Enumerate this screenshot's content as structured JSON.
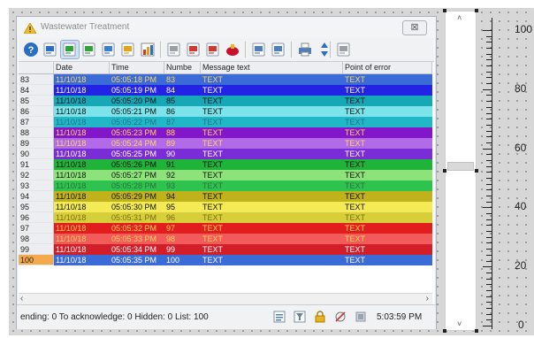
{
  "window": {
    "title": "Wastewater Treatment",
    "close_label": "⊠"
  },
  "toolbar": {
    "buttons": [
      {
        "name": "help-icon",
        "color": "#2a6ec4"
      },
      {
        "name": "refresh-icon",
        "color": "#2a6ec4"
      },
      {
        "name": "acknowledge-icon",
        "color": "#2fa33a"
      },
      {
        "name": "acknowledge-all-icon",
        "color": "#2fa33a"
      },
      {
        "name": "hide-icon",
        "color": "#3b7fd1"
      },
      {
        "name": "lock-icon",
        "color": "#e2a21a"
      },
      {
        "name": "statistics-icon",
        "color": "#d8a520"
      },
      {
        "name": "loop-in-alarm-icon",
        "color": "#9aa0a6"
      },
      {
        "name": "filter-list-icon",
        "color": "#d03a2e"
      },
      {
        "name": "alarm-list-icon",
        "color": "#d03a2e"
      },
      {
        "name": "horn-icon",
        "color": "#c8102e"
      },
      {
        "name": "settings-icon",
        "color": "#4d7fbd"
      },
      {
        "name": "edit-settings-icon",
        "color": "#4d7fbd"
      },
      {
        "name": "print-icon",
        "color": "#4d7fbd"
      },
      {
        "name": "sort-icon",
        "color": "#2a6ec4"
      },
      {
        "name": "export-icon",
        "color": "#9aa0a6"
      }
    ]
  },
  "table": {
    "columns": [
      "",
      "Date",
      "Time",
      "Numbe",
      "Message text",
      "Point of error"
    ],
    "rows": [
      {
        "num": "83",
        "date": "11/10/18",
        "time": "05:05:18 PM",
        "number": "83",
        "msg": "TEXT",
        "poe": "TEXT",
        "bg": "#3a6bd6",
        "fg": "#ffd85a"
      },
      {
        "num": "84",
        "date": "11/10/18",
        "time": "05:05:19 PM",
        "number": "84",
        "msg": "TEXT",
        "poe": "TEXT",
        "bg": "#2323e6",
        "fg": "#ffffff"
      },
      {
        "num": "85",
        "date": "11/10/18",
        "time": "05:05:20 PM",
        "number": "85",
        "msg": "TEXT",
        "poe": "TEXT",
        "bg": "#17a8b6",
        "fg": "#111111"
      },
      {
        "num": "86",
        "date": "11/10/18",
        "time": "05:05:21 PM",
        "number": "86",
        "msg": "TEXT",
        "poe": "TEXT",
        "bg": "#7de3ea",
        "fg": "#111111"
      },
      {
        "num": "87",
        "date": "11/10/18",
        "time": "05:05:22 PM",
        "number": "87",
        "msg": "TEXT",
        "poe": "TEXT",
        "bg": "#20b8c6",
        "fg": "#2a6f8a"
      },
      {
        "num": "88",
        "date": "11/10/18",
        "time": "05:05:23 PM",
        "number": "88",
        "msg": "TEXT",
        "poe": "TEXT",
        "bg": "#8416c9",
        "fg": "#ffd85a"
      },
      {
        "num": "89",
        "date": "11/10/18",
        "time": "05:05:24 PM",
        "number": "89",
        "msg": "TEXT",
        "poe": "TEXT",
        "bg": "#b26be8",
        "fg": "#ffd85a"
      },
      {
        "num": "90",
        "date": "11/10/18",
        "time": "05:05:25 PM",
        "number": "90",
        "msg": "TEXT",
        "poe": "TEXT",
        "bg": "#7a2dd6",
        "fg": "#ffffff"
      },
      {
        "num": "91",
        "date": "11/10/18",
        "time": "05:05:26 PM",
        "number": "91",
        "msg": "TEXT",
        "poe": "TEXT",
        "bg": "#1fb33a",
        "fg": "#111111"
      },
      {
        "num": "92",
        "date": "11/10/18",
        "time": "05:05:27 PM",
        "number": "92",
        "msg": "TEXT",
        "poe": "TEXT",
        "bg": "#8ee27a",
        "fg": "#111111"
      },
      {
        "num": "93",
        "date": "11/10/18",
        "time": "05:05:28 PM",
        "number": "93",
        "msg": "TEXT",
        "poe": "TEXT",
        "bg": "#2ec24e",
        "fg": "#2f6f3a"
      },
      {
        "num": "94",
        "date": "11/10/18",
        "time": "05:05:29 PM",
        "number": "94",
        "msg": "TEXT",
        "poe": "TEXT",
        "bg": "#bfb21a",
        "fg": "#111111"
      },
      {
        "num": "95",
        "date": "11/10/18",
        "time": "05:05:30 PM",
        "number": "95",
        "msg": "TEXT",
        "poe": "TEXT",
        "bg": "#f3ea55",
        "fg": "#111111"
      },
      {
        "num": "96",
        "date": "11/10/18",
        "time": "05:05:31 PM",
        "number": "96",
        "msg": "TEXT",
        "poe": "TEXT",
        "bg": "#d7cf3a",
        "fg": "#7a6a18"
      },
      {
        "num": "97",
        "date": "11/10/18",
        "time": "05:05:32 PM",
        "number": "97",
        "msg": "TEXT",
        "poe": "TEXT",
        "bg": "#e21d1d",
        "fg": "#ffd85a"
      },
      {
        "num": "98",
        "date": "11/10/18",
        "time": "05:05:33 PM",
        "number": "98",
        "msg": "TEXT",
        "poe": "TEXT",
        "bg": "#f35a5a",
        "fg": "#ffd85a"
      },
      {
        "num": "99",
        "date": "11/10/18",
        "time": "05:05:34 PM",
        "number": "99",
        "msg": "TEXT",
        "poe": "TEXT",
        "bg": "#d21e28",
        "fg": "#ffffff"
      },
      {
        "num": "100",
        "date": "11/10/18",
        "time": "05:05:35 PM",
        "number": "100",
        "msg": "TEXT",
        "poe": "TEXT",
        "bg": "#3a6bd6",
        "fg": "#ffffff",
        "num_bg": "#f4a94a"
      }
    ]
  },
  "scrollbar": {
    "left_arrow": "‹",
    "right_arrow": "›"
  },
  "status": {
    "text": "ending: 0  To acknowledge: 0  Hidden: 0  List: 100",
    "time": "5:03:59 PM",
    "icons": [
      "list-icon",
      "filter-icon",
      "lock-icon",
      "alarm-off-icon",
      "database-icon"
    ]
  },
  "slider": {
    "up_arrow": "˄",
    "down_arrow": "˅",
    "value_fraction": 0.53
  },
  "scale": {
    "labels": [
      "100",
      "80",
      "60",
      "40",
      "20",
      "0"
    ],
    "min": 0,
    "max": 100
  }
}
